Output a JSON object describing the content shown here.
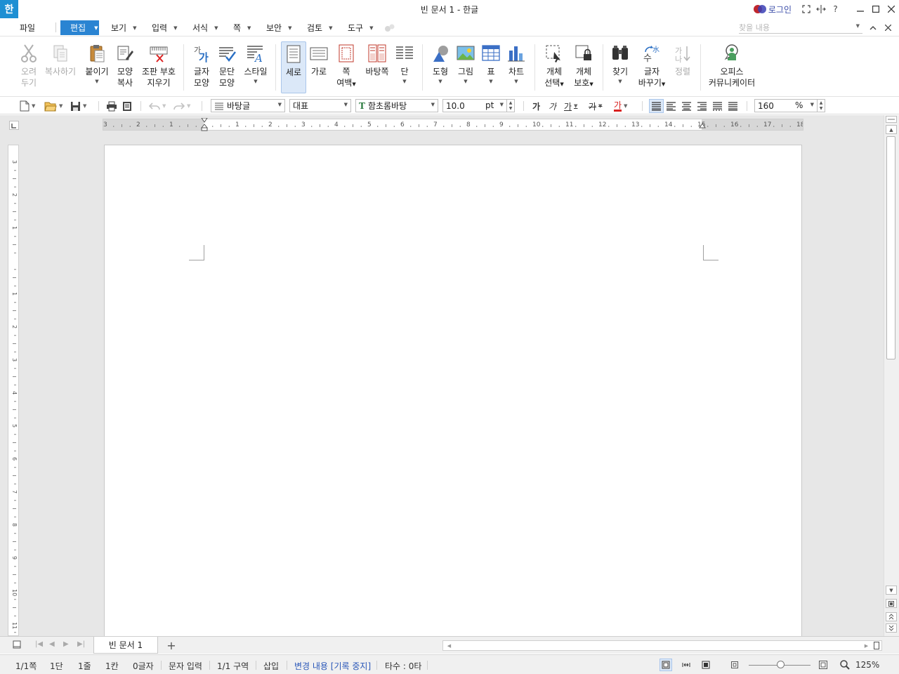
{
  "window": {
    "logo": "한",
    "title": "빈 문서 1 - 한글",
    "login": "로그인"
  },
  "menu": {
    "file": "파일",
    "items": [
      "편집",
      "보기",
      "입력",
      "서식",
      "쪽",
      "보안",
      "검토",
      "도구"
    ],
    "search_placeholder": "찾을 내용"
  },
  "ribbon": {
    "cut": [
      "오려",
      "두기"
    ],
    "copy": "복사하기",
    "paste": "붙이기",
    "format_copy": [
      "모양",
      "복사"
    ],
    "clear_marks": [
      "조판 부호",
      "지우기"
    ],
    "char_shape": [
      "글자",
      "모양"
    ],
    "para_shape": [
      "문단",
      "모양"
    ],
    "style": "스타일",
    "portrait": "세로",
    "landscape": "가로",
    "page_margin": [
      "쪽",
      "여백"
    ],
    "master_page": "바탕쪽",
    "column": "단",
    "shape": "도형",
    "picture": "그림",
    "table": "표",
    "chart": "차트",
    "object_select": [
      "개체",
      "선택"
    ],
    "object_protect": [
      "개체",
      "보호"
    ],
    "find": "찾기",
    "replace": [
      "글자",
      "바꾸기"
    ],
    "sort": "정렬",
    "office_comm": [
      "오피스",
      "커뮤니케이터"
    ]
  },
  "format": {
    "style_value": "바탕글",
    "lang_value": "대표",
    "font_value": "함초롬바탕",
    "size_value": "10.0",
    "size_unit": "pt",
    "bold_glyph": "가",
    "italic_glyph": "가",
    "underline_glyph": "가",
    "strike_glyph": "가",
    "color_glyph": "가",
    "zoom_value": "160",
    "zoom_unit": "%"
  },
  "ruler": {
    "h_labels": [
      "3",
      "2",
      "1",
      "",
      "1",
      "2",
      "3",
      "4",
      "5",
      "6",
      "7",
      "8",
      "9",
      "10",
      "11",
      "12",
      "13",
      "14",
      "15",
      "16",
      "17",
      "18"
    ],
    "v_labels": [
      "3",
      "2",
      "1",
      "",
      "1",
      "2",
      "3",
      "4",
      "5",
      "6",
      "7",
      "8",
      "9",
      "10",
      "11"
    ]
  },
  "tabs": {
    "doc_tab": "빈 문서 1",
    "add": "+"
  },
  "status": {
    "page": "1/1쪽",
    "column": "1단",
    "line": "1줄",
    "col": "1칸",
    "chars": "0글자",
    "input_mode": "문자 입력",
    "section": "1/1 구역",
    "insert": "삽입",
    "track": "변경 내용 [기록 중지]",
    "typing": "타수 : 0타",
    "zoom": "125%"
  }
}
